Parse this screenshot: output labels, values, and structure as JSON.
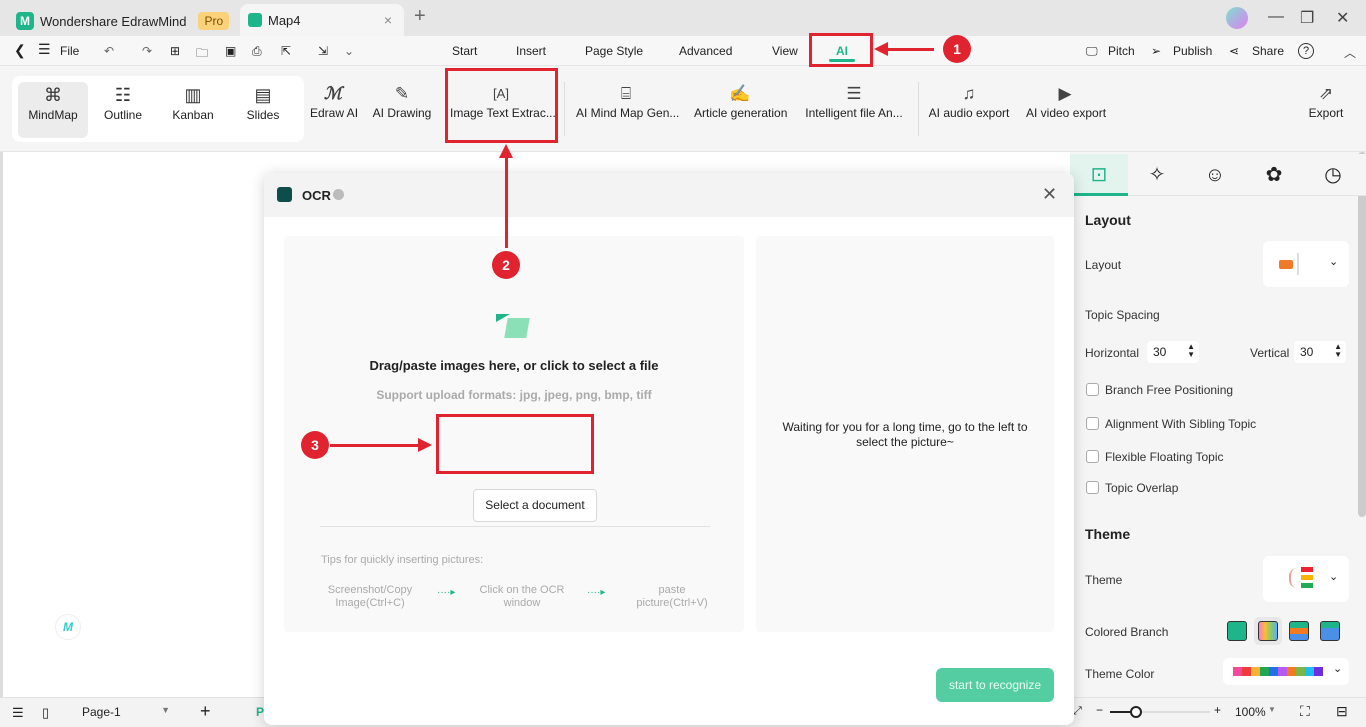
{
  "titlebar": {
    "app_name": "Wondershare EdrawMind",
    "badge": "Pro",
    "doc_tab": "Map4",
    "close_tab": "×",
    "new_tab": "+",
    "minimize": "—",
    "maximize": "❐",
    "close": "✕"
  },
  "menubar": {
    "back": "❮",
    "menu": "☰",
    "file": "File",
    "tabs": [
      "Start",
      "Insert",
      "Page Style",
      "Advanced",
      "View",
      "AI"
    ],
    "active_tab": "AI",
    "right": {
      "pitch": "Pitch",
      "publish": "Publish",
      "share": "Share",
      "help": "?"
    }
  },
  "ribbon": {
    "views": [
      {
        "label": "MindMap",
        "icon": "mindmap-icon",
        "glyph": "⌘"
      },
      {
        "label": "Outline",
        "icon": "outline-icon",
        "glyph": "☷"
      },
      {
        "label": "Kanban",
        "icon": "kanban-icon",
        "glyph": "▥"
      },
      {
        "label": "Slides",
        "icon": "slides-icon",
        "glyph": "▤"
      }
    ],
    "ai_tools": [
      {
        "label": "Edraw AI",
        "glyph": "ℳ"
      },
      {
        "label": "AI Drawing",
        "glyph": "✎"
      },
      {
        "label": "Image Text Extrac...",
        "glyph": "[A]"
      },
      {
        "label": "AI Mind Map Gen...",
        "glyph": "⌸"
      },
      {
        "label": "Article generation",
        "glyph": "✍"
      },
      {
        "label": "Intelligent file An...",
        "glyph": "☰"
      },
      {
        "label": "AI audio export",
        "glyph": "♫"
      },
      {
        "label": "AI video export",
        "glyph": "▶"
      }
    ],
    "export": "Export"
  },
  "ocr": {
    "title": "OCR",
    "drop_title": "Drag/paste images here, or click to select a file",
    "formats": "Support upload formats: jpg, jpeg, png, bmp, tiff",
    "select_button": "Select a document",
    "tips_title": "Tips for quickly inserting pictures:",
    "tips": [
      "Screenshot/Copy Image(Ctrl+C)",
      "Click on the OCR window",
      "paste picture(Ctrl+V)"
    ],
    "waiting": "Waiting for you for a long time, go to the left to select the picture~",
    "recognize_button": "start to recognize"
  },
  "panel": {
    "layout_head": "Layout",
    "layout_label": "Layout",
    "topic_spacing": "Topic Spacing",
    "horizontal_label": "Horizontal",
    "horizontal_value": "30",
    "vertical_label": "Vertical",
    "vertical_value": "30",
    "checkboxes": [
      {
        "label": "Branch Free Positioning",
        "checked": false
      },
      {
        "label": "Alignment With Sibling Topic",
        "checked": false
      },
      {
        "label": "Flexible Floating Topic",
        "checked": false
      },
      {
        "label": "Topic Overlap",
        "checked": false
      }
    ],
    "theme_head": "Theme",
    "theme_label": "Theme",
    "colored_branch": "Colored Branch",
    "theme_color": "Theme Color",
    "palette": [
      "#f24a9a",
      "#ee3b3b",
      "#f9b233",
      "#22a652",
      "#2170e8",
      "#b65af2",
      "#f47a22",
      "#7ab648",
      "#1fbcf2",
      "#6b2ee0"
    ]
  },
  "statusbar": {
    "page": "Page-1",
    "add": "+",
    "zoom": "100%"
  },
  "annotations": [
    "1",
    "2",
    "3"
  ],
  "colors": {
    "accent": "#1fb58a",
    "annotation": "#e0232e"
  }
}
